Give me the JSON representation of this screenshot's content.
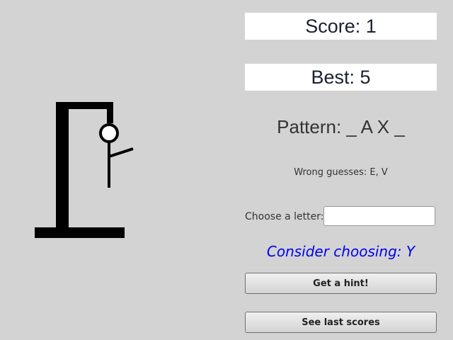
{
  "score": {
    "text": "Score: 1"
  },
  "best": {
    "text": "Best: 5"
  },
  "pattern": {
    "text": "Pattern: _ A X _"
  },
  "wrong_guesses": {
    "text": "Wrong guesses: E, V"
  },
  "letter_input": {
    "label": "Choose a letter:",
    "value": ""
  },
  "suggestion": {
    "text": "Consider choosing: Y"
  },
  "buttons": {
    "hint": "Get a hint!",
    "last_scores": "See last scores"
  },
  "hangman": {
    "wrong_count": 2,
    "body_parts_shown": [
      "head",
      "body"
    ]
  },
  "colors": {
    "background": "#d3d3d3",
    "suggestion": "#0000ee"
  }
}
